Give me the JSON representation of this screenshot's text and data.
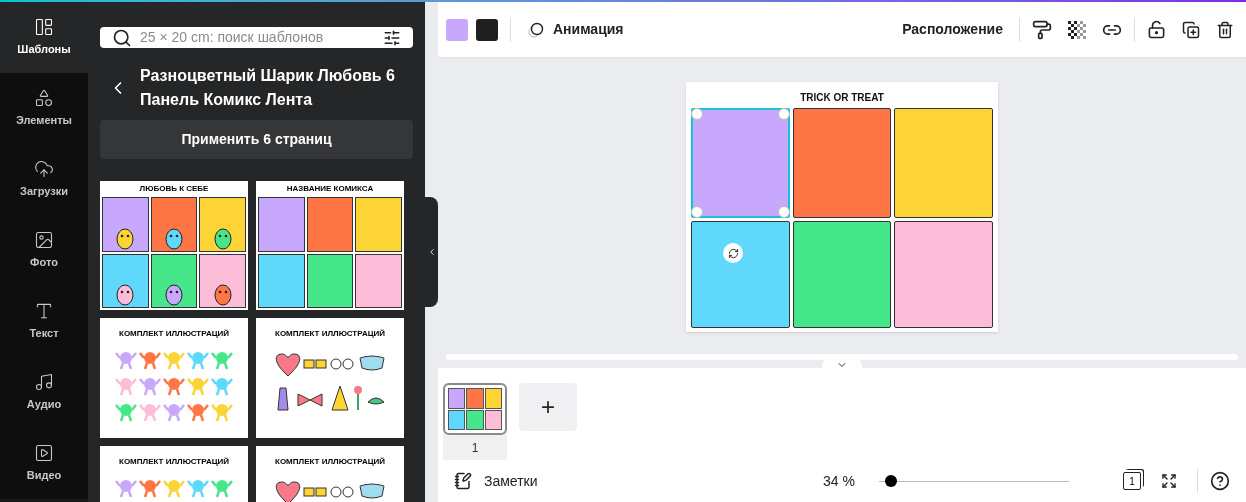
{
  "sidebar": {
    "items": [
      {
        "label": "Шаблоны",
        "selected": true
      },
      {
        "label": "Элементы",
        "selected": false
      },
      {
        "label": "Загрузки",
        "selected": false
      },
      {
        "label": "Фото",
        "selected": false
      },
      {
        "label": "Текст",
        "selected": false
      },
      {
        "label": "Аудио",
        "selected": false
      },
      {
        "label": "Видео",
        "selected": false
      }
    ]
  },
  "panel": {
    "search": {
      "placeholder": "25 × 20 cm: поиск шаблонов"
    },
    "title": "Разноцветный Шарик Любовь 6 Панель Комикс Лента",
    "apply_button": "Применить 6 страниц",
    "templates": [
      {
        "kind": "comic",
        "heading": "ЛЮБОВЬ К СЕБЕ"
      },
      {
        "kind": "blank",
        "heading": "НАЗВАНИЕ КОМИКСА"
      },
      {
        "kind": "characters",
        "heading": "КОМПЛЕКТ ИЛЛЮСТРАЦИЙ"
      },
      {
        "kind": "props",
        "heading": "КОМПЛЕКТ ИЛЛЮСТРАЦИЙ"
      },
      {
        "kind": "characters",
        "heading": "КОМПЛЕКТ ИЛЛЮСТРАЦИЙ"
      },
      {
        "kind": "props",
        "heading": "КОМПЛЕКТ ИЛЛЮСТРАЦИЙ"
      }
    ]
  },
  "toolbar": {
    "fill_colors": [
      {
        "color": "#c8a8fc"
      },
      {
        "color": "#1f1f1f"
      }
    ],
    "animation": "Анимация",
    "position": "Расположение"
  },
  "design": {
    "title": "TRICK OR TREAT",
    "cells": [
      {
        "color": "#c8a8fc",
        "selected": true
      },
      {
        "color": "#fe7645",
        "selected": false
      },
      {
        "color": "#fdd435",
        "selected": false
      },
      {
        "color": "#5fd8fc",
        "selected": false
      },
      {
        "color": "#46e68a",
        "selected": false
      },
      {
        "color": "#fdbcd8",
        "selected": false
      }
    ]
  },
  "pages": [
    {
      "number": "1",
      "selected": true
    }
  ],
  "add_page": "+",
  "footer": {
    "notes": "Заметки",
    "zoom": "34 %",
    "zoom_level": {
      "level": 0.03
    },
    "page_count": "1"
  }
}
